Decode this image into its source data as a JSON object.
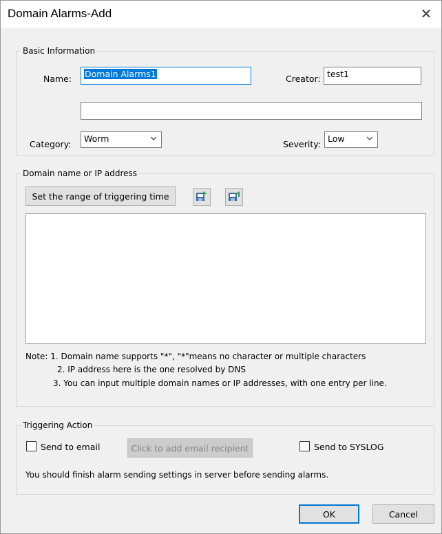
{
  "window": {
    "title": "Domain Alarms-Add",
    "close_glyph": "✕"
  },
  "basic_info": {
    "legend": "Basic Information",
    "name_label": "Name:",
    "name_value": "Domain Alarms1",
    "creator_label": "Creator:",
    "creator_value": "test1",
    "description_value": "",
    "category_label": "Category:",
    "category_value": "Worm",
    "severity_label": "Severity:",
    "severity_value": "Low"
  },
  "domain": {
    "legend": "Domain name or IP address",
    "range_button": "Set the range of triggering time",
    "import_icon": "import-icon",
    "export_icon": "export-icon",
    "notes": [
      "Note: 1. Domain name supports \"*\", \"*\"means no character or multiple characters",
      "2. IP address here is the one resolved by DNS",
      "3. You can input multiple domain names or IP addresses, with one entry per line."
    ]
  },
  "action": {
    "legend": "Triggering Action",
    "send_email_label": "Send to email",
    "send_email_checked": false,
    "add_recipient_button": "Click to add email recipient",
    "send_syslog_label": "Send to SYSLOG",
    "send_syslog_checked": false,
    "hint": "You should finish alarm sending settings in server before sending alarms."
  },
  "footer": {
    "ok": "OK",
    "cancel": "Cancel"
  },
  "colors": {
    "accent": "#0078d7",
    "dialog_bg": "#f0f0f0"
  }
}
